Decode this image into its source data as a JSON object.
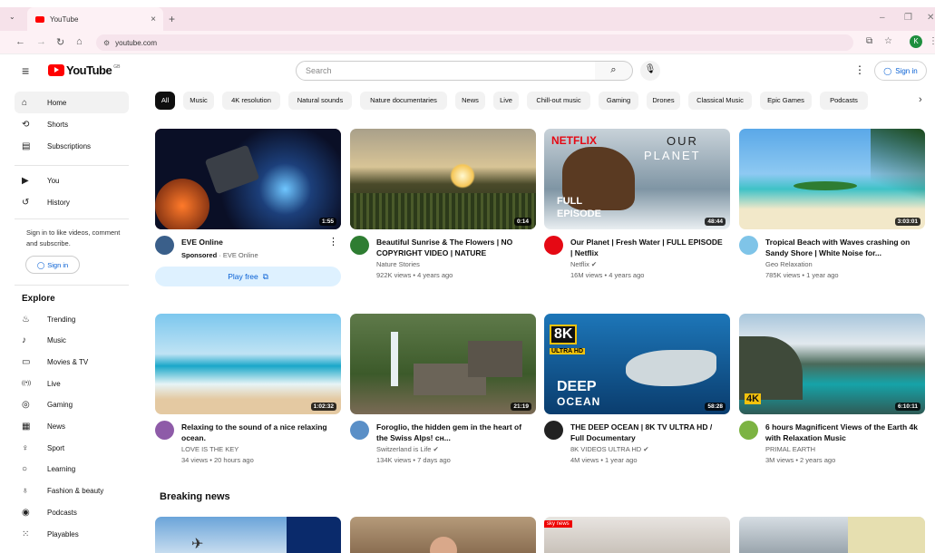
{
  "browser": {
    "tab_title": "YouTube",
    "tab_close": "×",
    "new_tab": "+",
    "tab_menu": "⌄",
    "minimize": "–",
    "restore": "❐",
    "close": "✕",
    "url": "youtube.com",
    "profile_initial": "K"
  },
  "masthead": {
    "logo_text": "YouTube",
    "country_code": "GB",
    "search_placeholder": "Search",
    "sign_in": "Sign in"
  },
  "sidebar": {
    "primary": [
      {
        "label": "Home",
        "icon": "home-icon",
        "glyph": "⌂",
        "active": true
      },
      {
        "label": "Shorts",
        "icon": "shorts-icon",
        "glyph": "⟲"
      },
      {
        "label": "Subscriptions",
        "icon": "subscriptions-icon",
        "glyph": "▤"
      }
    ],
    "you": [
      {
        "label": "You",
        "icon": "you-icon",
        "glyph": "▶"
      },
      {
        "label": "History",
        "icon": "history-icon",
        "glyph": "↺"
      }
    ],
    "signin_note": "Sign in to like videos, comment and subscribe.",
    "signin_button": "Sign in",
    "explore_heading": "Explore",
    "explore": [
      {
        "label": "Trending",
        "icon": "trending-icon",
        "glyph": "♨"
      },
      {
        "label": "Music",
        "icon": "music-icon",
        "glyph": "♪"
      },
      {
        "label": "Movies & TV",
        "icon": "movies-icon",
        "glyph": "▭"
      },
      {
        "label": "Live",
        "icon": "live-icon",
        "glyph": "((•))"
      },
      {
        "label": "Gaming",
        "icon": "gaming-icon",
        "glyph": "◎"
      },
      {
        "label": "News",
        "icon": "news-icon",
        "glyph": "▦"
      },
      {
        "label": "Sport",
        "icon": "sport-icon",
        "glyph": "♀"
      },
      {
        "label": "Learning",
        "icon": "learning-icon",
        "glyph": "○"
      },
      {
        "label": "Fashion & beauty",
        "icon": "fashion-icon",
        "glyph": "♁"
      },
      {
        "label": "Podcasts",
        "icon": "podcasts-icon",
        "glyph": "◉"
      },
      {
        "label": "Playables",
        "icon": "playables-icon",
        "glyph": "⁙"
      }
    ]
  },
  "chips": [
    "All",
    "Music",
    "4K resolution",
    "Natural sounds",
    "Nature documentaries",
    "News",
    "Live",
    "Chill-out music",
    "Gaming",
    "Drones",
    "Classical Music",
    "Epic Games",
    "Podcasts"
  ],
  "videos": [
    {
      "title": "EVE Online",
      "sponsored_label": "Sponsored",
      "channel": "EVE Online",
      "cta": "Play free",
      "duration": "1:55",
      "ad": true,
      "avatar_color": "#3a5f8a"
    },
    {
      "title": "Beautiful Sunrise & The Flowers | NO COPYRIGHT VIDEO | NATURE",
      "channel": "Nature Stories",
      "meta": "922K views • 4 years ago",
      "duration": "0:14",
      "avatar_color": "#2e7d32"
    },
    {
      "title": "Our Planet | Fresh Water | FULL EPISODE | Netflix",
      "channel": "Netflix ✔",
      "meta": "16M views • 4 years ago",
      "duration": "48:44",
      "avatar_color": "#e50914",
      "thumb_brand": "NETFLIX",
      "thumb_title1": "OUR",
      "thumb_title2": "PLANET",
      "thumb_tag1": "FULL",
      "thumb_tag2": "EPISODE"
    },
    {
      "title": "Tropical Beach with Waves crashing on Sandy Shore | White Noise for...",
      "channel": "Geo Relaxation",
      "meta": "785K views • 1 year ago",
      "duration": "3:03:01",
      "avatar_color": "#7fc4e8"
    },
    {
      "title": "Relaxing to the sound of a nice relaxing ocean.",
      "channel": "LOVE IS THE KEY",
      "meta": "34 views • 20 hours ago",
      "duration": "1:02:32",
      "avatar_color": "#8e5ba8"
    },
    {
      "title": "Foroglio, the hidden gem in the heart of the Swiss Alps! ᴄʜ...",
      "channel": "Switzerland is Life ✔",
      "meta": "134K views • 7 days ago",
      "duration": "21:19",
      "avatar_color": "#5a8fc7"
    },
    {
      "title": "THE DEEP OCEAN | 8K TV ULTRA HD / Full Documentary",
      "channel": "8K VIDEOS ULTRA HD ✔",
      "meta": "4M views • 1 year ago",
      "duration": "58:28",
      "avatar_color": "#222",
      "thumb_badge": "8K",
      "thumb_badge2": "ULTRA HD",
      "thumb_title1": "DEEP",
      "thumb_title2": "OCEAN"
    },
    {
      "title": "6 hours Magnificent Views of the Earth 4k with Relaxation Music",
      "channel": "PRIMAL EARTH",
      "meta": "3M views • 2 years ago",
      "duration": "6:10:11",
      "avatar_color": "#7cb342",
      "thumb_badge": "4K"
    }
  ],
  "breaking_news": "Breaking news",
  "breaking_thumb_label": "sky news"
}
